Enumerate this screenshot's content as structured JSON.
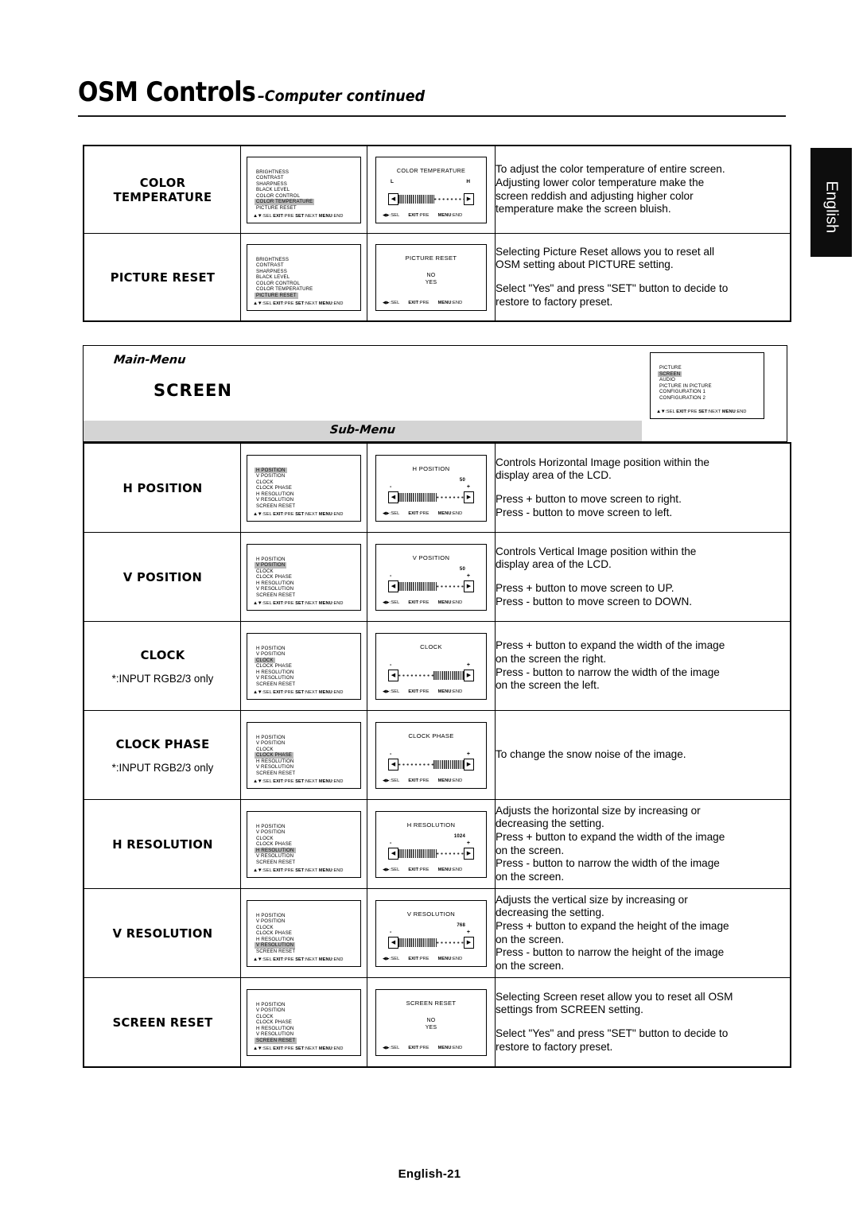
{
  "header": {
    "title_main": "OSM Controls",
    "title_sub": "–Computer continued"
  },
  "lang_tab": {
    "label": "English"
  },
  "footer": {
    "page_label": "English-21"
  },
  "osd_common": {
    "foot_left": ":SEL",
    "foot_left_arrows": "▲▼",
    "foot_exit": "EXIT",
    "foot_exit_val": ":PRE",
    "foot_set": "SET",
    "foot_set_val": ":NEXT",
    "foot_menu": "MENU",
    "foot_menu_val": ":END",
    "foot_lr_arrows": "◀▶",
    "btn_left": "◀",
    "btn_right": "▶",
    "minus": "-",
    "plus": "+"
  },
  "picture_menu_items": [
    "BRIGHTNESS",
    "CONTRAST",
    "SHARPNESS",
    "BLACK LEVEL",
    "COLOR CONTROL",
    "COLOR TEMPERATURE",
    "PICTURE RESET"
  ],
  "screen_menu_items": [
    "H POSITION",
    "V POSITION",
    "CLOCK",
    "CLOCK PHASE",
    "H RESOLUTION",
    "V RESOLUTION",
    "SCREEN RESET"
  ],
  "main_menu_items": [
    "PICTURE",
    "SCREEN",
    "AUDIO",
    "PICTURE IN PICTURE",
    "CONFIGURATION 1",
    "CONFIGURATION 2"
  ],
  "main_menu_selected": "SCREEN",
  "banner": {
    "main_menu_label": "Main-Menu",
    "main_menu_name": "SCREEN",
    "sub_menu_label": "Sub-Menu"
  },
  "table_top": {
    "rows": [
      {
        "label": "COLOR TEMPERATURE",
        "note": "",
        "menu_selected": "COLOR TEMPERATURE",
        "osd_title": "COLOR TEMPERATURE",
        "osd_kind": "slider_lh",
        "left_mark": "L",
        "right_mark": "H",
        "value": "",
        "fill_side": "left",
        "fill_pct": 55,
        "description": [
          "To adjust the color temperature of entire screen.",
          "Adjusting lower color temperature make the",
          "screen reddish and adjusting higher color",
          "temperature make the screen bluish."
        ],
        "description_blocks": [
          [
            "To adjust the color temperature of entire screen.",
            "Adjusting lower color temperature make the",
            "screen reddish and adjusting higher color",
            "temperature make the screen bluish."
          ]
        ]
      },
      {
        "label": "PICTURE RESET",
        "note": "",
        "menu_selected": "PICTURE RESET",
        "osd_title": "PICTURE RESET",
        "osd_kind": "choices",
        "choices": [
          "NO",
          "YES"
        ],
        "description_blocks": [
          [
            "Selecting Picture Reset allows you to reset all",
            "OSM setting about PICTURE setting."
          ],
          [
            "Select \"Yes\" and press \"SET\" button to decide to",
            "restore to factory preset."
          ]
        ]
      }
    ]
  },
  "table_screen": {
    "rows": [
      {
        "label": "H POSITION",
        "note": "",
        "menu_selected": "H POSITION",
        "osd_title": "H POSITION",
        "osd_kind": "slider_value",
        "value": "50",
        "fill_side": "left",
        "fill_pct": 58,
        "description_blocks": [
          [
            "Controls Horizontal Image position within the",
            "display area of the LCD."
          ],
          [
            "Press + button to move screen to right.",
            "Press - button to move screen to left."
          ]
        ]
      },
      {
        "label": "V POSITION",
        "note": "",
        "menu_selected": "V POSITION",
        "osd_title": "V POSITION",
        "osd_kind": "slider_value",
        "value": "50",
        "fill_side": "left",
        "fill_pct": 58,
        "description_blocks": [
          [
            "Controls Vertical Image position within the",
            "display area of the LCD."
          ],
          [
            "Press + button to move screen to UP.",
            "Press - button to move screen to DOWN."
          ]
        ]
      },
      {
        "label": "CLOCK",
        "note": "*:INPUT RGB2/3 only",
        "menu_selected": "CLOCK",
        "osd_title": "CLOCK",
        "osd_kind": "slider_plain",
        "value": "",
        "fill_side": "right",
        "fill_pct": 46,
        "description_blocks": [
          [
            "Press + button to expand the width of the image",
            "on the screen the right.",
            "Press - button to narrow the width of the image",
            "on the screen the left."
          ]
        ]
      },
      {
        "label": "CLOCK PHASE",
        "note": "*:INPUT RGB2/3 only",
        "menu_selected": "CLOCK PHASE",
        "osd_title": "CLOCK PHASE",
        "osd_kind": "slider_plain",
        "value": "",
        "fill_side": "right",
        "fill_pct": 46,
        "description_blocks": [
          [
            "To change the snow noise of the image."
          ]
        ]
      },
      {
        "label": "H RESOLUTION",
        "note": "",
        "menu_selected": "H RESOLUTION",
        "osd_title": "H RESOLUTION",
        "osd_kind": "slider_value",
        "value": "1024",
        "fill_side": "left",
        "fill_pct": 58,
        "description_blocks": [
          [
            "Adjusts the horizontal size by increasing or",
            "decreasing the setting.",
            "Press + button to expand the width of the image",
            "on the screen.",
            "Press - button to narrow the width of the image",
            "on the screen."
          ]
        ]
      },
      {
        "label": "V RESOLUTION",
        "note": "",
        "menu_selected": "V RESOLUTION",
        "osd_title": "V RESOLUTION",
        "osd_kind": "slider_value",
        "value": "768",
        "fill_side": "left",
        "fill_pct": 58,
        "description_blocks": [
          [
            "Adjusts the vertical size by increasing or",
            "decreasing the setting.",
            "Press + button to expand the height of the image",
            "on the screen.",
            "Press - button to narrow the height of the image",
            "on the screen."
          ]
        ]
      },
      {
        "label": "SCREEN RESET",
        "note": "",
        "menu_selected": "SCREEN RESET",
        "osd_title": "SCREEN RESET",
        "osd_kind": "choices",
        "choices": [
          "NO",
          "YES"
        ],
        "description_blocks": [
          [
            "Selecting Screen reset allow you to reset all OSM",
            "settings from SCREEN setting."
          ],
          [
            "Select \"Yes\" and press \"SET\" button to decide to",
            "restore to factory preset."
          ]
        ]
      }
    ]
  }
}
